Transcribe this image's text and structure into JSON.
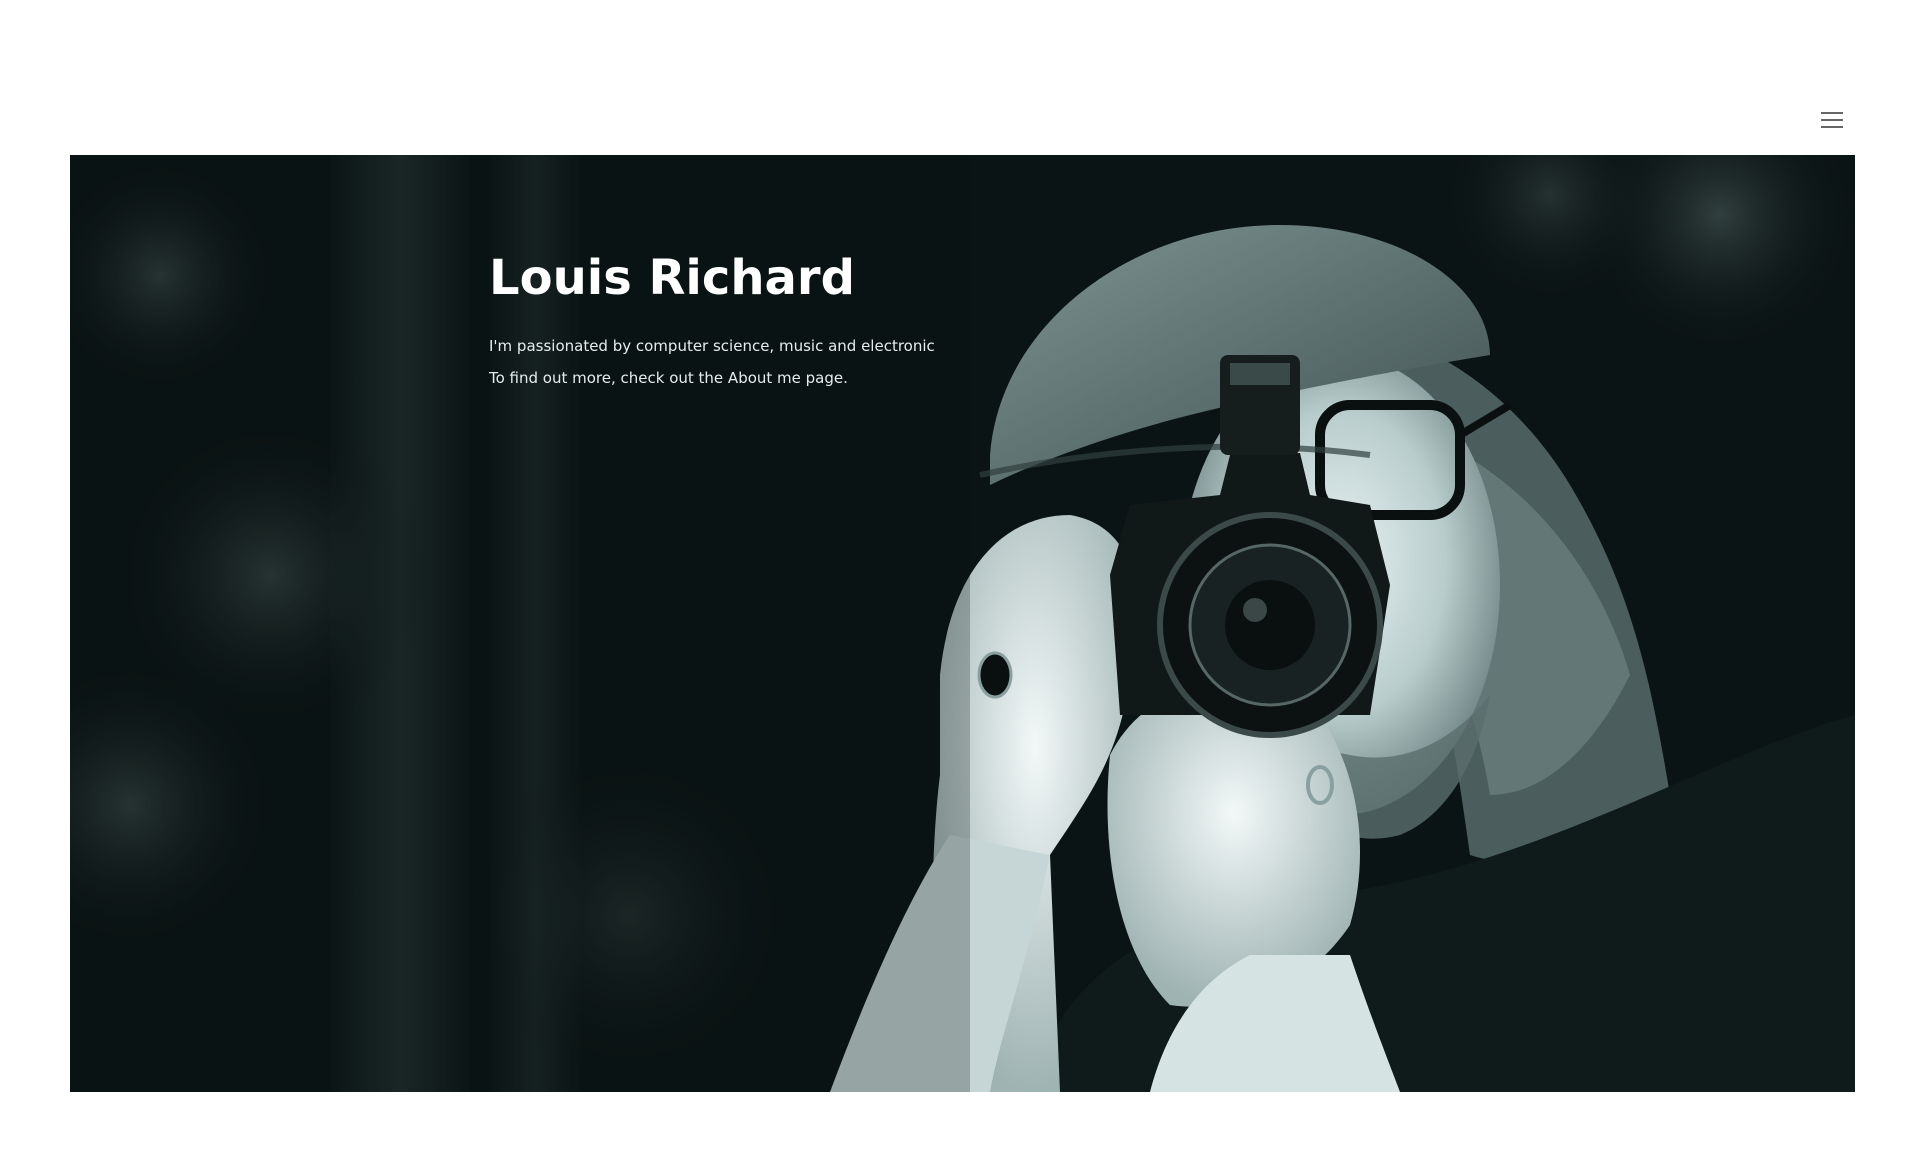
{
  "header": {
    "menu_icon": "hamburger-menu-icon"
  },
  "hero": {
    "title": "Louis Richard",
    "lines": [
      "I'm passionated by computer science, music and electronic",
      "To find out more, check out the About me page."
    ],
    "colors": {
      "title": "#ffffff",
      "text": "#e6ecec",
      "photo_dark": "#0b1414",
      "photo_light": "#c8dede"
    }
  }
}
